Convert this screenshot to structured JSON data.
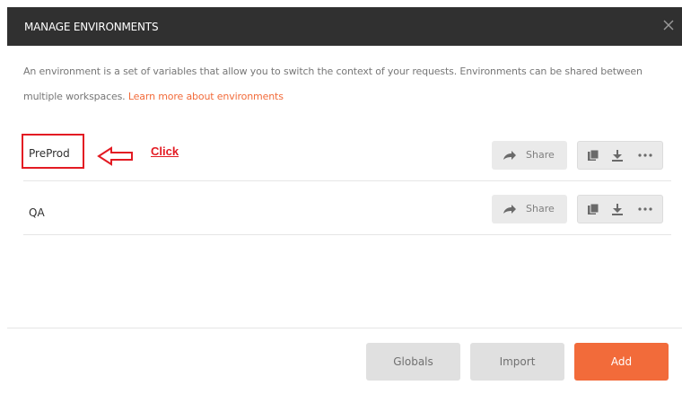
{
  "modal": {
    "title": "MANAGE ENVIRONMENTS",
    "close_icon": "close-icon"
  },
  "description": {
    "text": "An environment is a set of variables that allow you to switch the context of your requests. Environments can be shared between multiple workspaces.",
    "link": "Learn more about environments"
  },
  "annotation": {
    "click_label": "Click",
    "color": "#e31b23"
  },
  "environments": [
    {
      "name": "PreProd",
      "share_label": "Share",
      "actions": [
        "duplicate-icon",
        "download-icon",
        "more-icon"
      ]
    },
    {
      "name": "QA",
      "share_label": "Share",
      "actions": [
        "duplicate-icon",
        "download-icon",
        "more-icon"
      ]
    }
  ],
  "footer": {
    "globals_label": "Globals",
    "import_label": "Import",
    "add_label": "Add"
  },
  "colors": {
    "accent": "#f26b3a",
    "header_bg": "#303030"
  }
}
